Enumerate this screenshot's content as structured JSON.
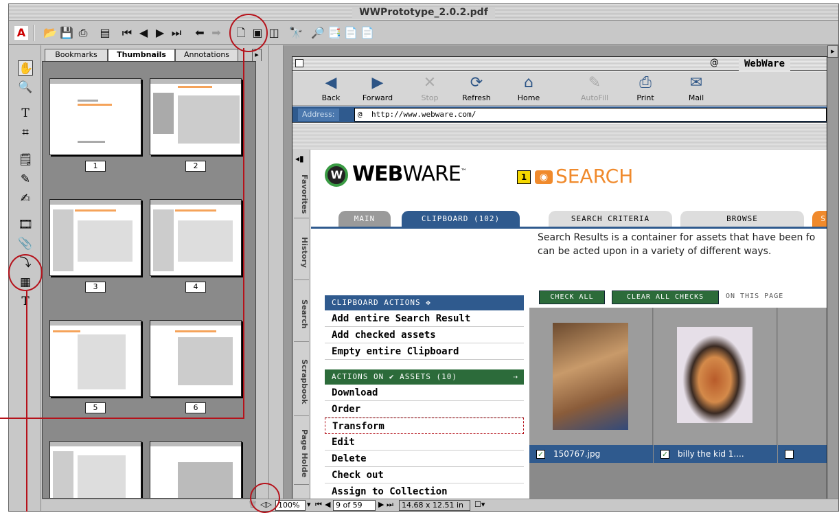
{
  "window": {
    "title": "WWPrototype_2.0.2.pdf"
  },
  "toolbar": {
    "icons": [
      "acrobat-logo",
      "open-icon",
      "save-icon",
      "print-icon",
      "show-hide-navpane-icon",
      "first-page-icon",
      "prev-page-icon",
      "next-page-icon",
      "last-page-icon",
      "go-back-icon",
      "go-forward-icon",
      "actual-size-icon",
      "fit-page-icon",
      "fit-width-icon",
      "find-icon",
      "search-icon",
      "search-results-icon",
      "prev-highlight-icon",
      "next-highlight-icon"
    ]
  },
  "navpane": {
    "tabs": [
      "Bookmarks",
      "Thumbnails",
      "Annotations"
    ],
    "active_tab": "Thumbnails",
    "thumb_labels": [
      "1",
      "2",
      "3",
      "4",
      "5",
      "6"
    ]
  },
  "browser": {
    "title": "WebWare",
    "buttons": [
      "Back",
      "Forward",
      "Stop",
      "Refresh",
      "Home",
      "AutoFill",
      "Print",
      "Mail"
    ],
    "address_label": "Address:",
    "address_value": "http://www.webware.com/",
    "side_tabs": [
      "Favorites",
      "History",
      "Search",
      "Scrapbook",
      "Page Holde"
    ],
    "logo_bold": "WEB",
    "logo_light": "WARE",
    "logo_tm": "™",
    "search_label": "SEARCH",
    "tabs": [
      "MAIN",
      "CLIPBOARD (102)",
      "SEARCH CRITERIA",
      "BROWSE",
      "SE"
    ],
    "description_line1": "Search Results is a container for assets that have been fo",
    "description_line2": "can be acted upon in a variety of different ways.",
    "clipboard_header": "CLIPBOARD ACTIONS",
    "clipboard_actions": [
      "Add entire Search Result",
      "Add checked assets",
      "Empty entire Clipboard"
    ],
    "assets_header_a": "ACTIONS ON",
    "assets_header_b": "ASSETS (10)",
    "asset_actions": [
      "Download",
      "Order",
      "Transform",
      "Edit",
      "Delete",
      "Check out",
      "Assign to Collection"
    ],
    "check_all": "CHECK ALL",
    "clear_all": "CLEAR ALL CHECKS",
    "on_this_page": "ON THIS PAGE",
    "results": [
      {
        "name": "150767.jpg",
        "checked": true
      },
      {
        "name": "billy the kid 1....",
        "checked": true
      },
      {
        "name": "",
        "checked": false
      }
    ]
  },
  "status": {
    "zoom": "100%",
    "page": "9 of 59",
    "size": "14.68 x 12.51 in"
  },
  "colors": {
    "annotation_red": "#b5121b",
    "webware_blue": "#2f5a8e",
    "webware_green": "#2c6b3a",
    "webware_orange": "#f08a2c"
  }
}
